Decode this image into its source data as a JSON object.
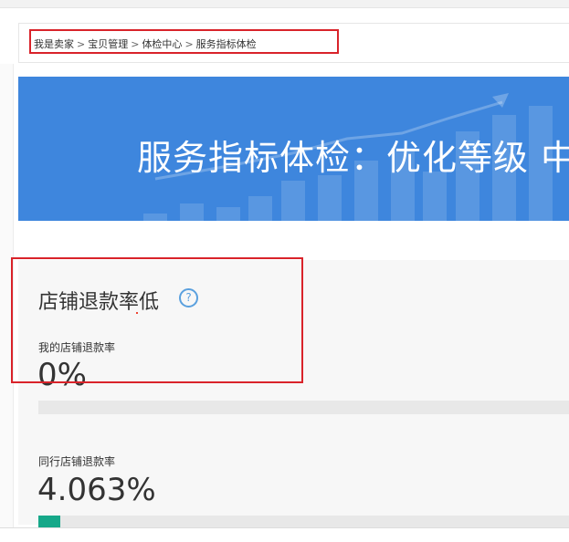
{
  "breadcrumb": {
    "items": [
      "我是卖家",
      "宝贝管理",
      "体检中心",
      "服务指标体检"
    ],
    "separator": ">"
  },
  "banner": {
    "title": "服务指标体检：优化等级 中"
  },
  "metric": {
    "title": "店铺退款率低",
    "my_label": "我的店铺退款率",
    "my_value": "0%",
    "my_progress": 0,
    "peer_label": "同行店铺退款率",
    "peer_value": "4.063%",
    "peer_progress": 0.04063
  },
  "colors": {
    "banner": "#3e86dd",
    "progress": "#16a889",
    "callout": "#d9232a",
    "help": "#5aa0de"
  },
  "icons": {
    "help": "question-circle-icon"
  }
}
